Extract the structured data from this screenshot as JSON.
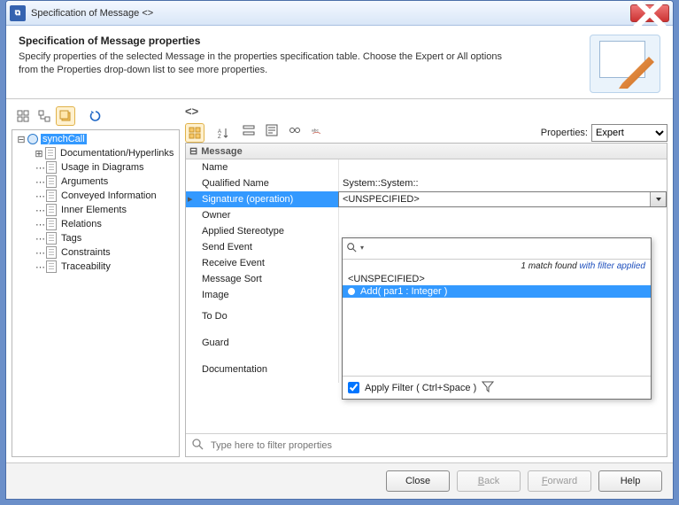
{
  "window": {
    "title": "Specification of Message <>"
  },
  "header": {
    "title": "Specification of Message properties",
    "description": "Specify properties of the selected Message in the properties specification table. Choose the Expert or All options from the Properties drop-down list to see more properties."
  },
  "tree": {
    "root": "synchCall",
    "items": [
      "Documentation/Hyperlinks",
      "Usage in Diagrams",
      "Arguments",
      "Conveyed Information",
      "Inner Elements",
      "Relations",
      "Tags",
      "Constraints",
      "Traceability"
    ]
  },
  "breadcrumb": "<>",
  "options": {
    "properties_label": "Properties:",
    "properties_value": "Expert"
  },
  "group": "Message",
  "rows": [
    {
      "name": "Name",
      "value": ""
    },
    {
      "name": "Qualified Name",
      "value": "System::System::"
    },
    {
      "name": "Signature (operation)",
      "value": "<UNSPECIFIED>",
      "selected": true
    },
    {
      "name": "Owner",
      "value": ""
    },
    {
      "name": "Applied Stereotype",
      "value": ""
    },
    {
      "name": "Send Event",
      "value": ""
    },
    {
      "name": "Receive Event",
      "value": ""
    },
    {
      "name": "Message Sort",
      "value": ""
    },
    {
      "name": "Image",
      "value": ""
    },
    {
      "name": "To Do",
      "value": "",
      "tall": true
    },
    {
      "name": "Guard",
      "value": "",
      "tall": true
    },
    {
      "name": "Documentation",
      "value": "",
      "tall": true
    }
  ],
  "popup": {
    "status_count": "1 match found ",
    "status_suffix": "with filter applied",
    "options": [
      {
        "label": "<UNSPECIFIED>",
        "selected": false
      },
      {
        "label": "Add( par1 : Integer )",
        "selected": true,
        "bullet": true
      }
    ],
    "filter_label": "Apply Filter ( Ctrl+Space )"
  },
  "filter": {
    "placeholder": "Type here to filter properties"
  },
  "buttons": {
    "close": "Close",
    "back": "Back",
    "forward": "Forward",
    "help": "Help"
  }
}
